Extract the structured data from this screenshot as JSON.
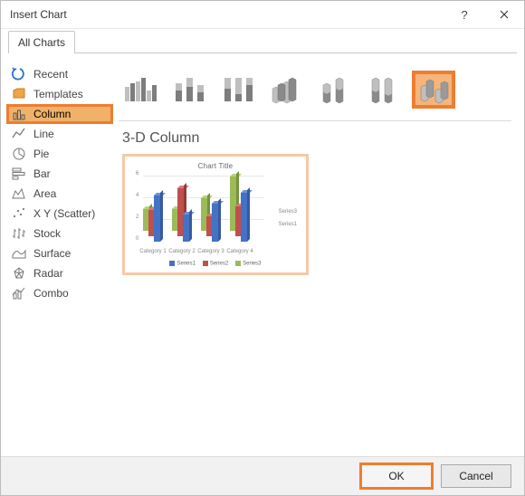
{
  "window": {
    "title": "Insert Chart"
  },
  "tabs": {
    "all": "All Charts"
  },
  "sidebar": {
    "items": [
      {
        "label": "Recent"
      },
      {
        "label": "Templates"
      },
      {
        "label": "Column"
      },
      {
        "label": "Line"
      },
      {
        "label": "Pie"
      },
      {
        "label": "Bar"
      },
      {
        "label": "Area"
      },
      {
        "label": "X Y (Scatter)"
      },
      {
        "label": "Stock"
      },
      {
        "label": "Surface"
      },
      {
        "label": "Radar"
      },
      {
        "label": "Combo"
      }
    ],
    "selected_index": 2
  },
  "main": {
    "subtype_names": [
      "clustered-column",
      "stacked-column",
      "100pct-stacked-column",
      "3d-clustered-column",
      "3d-stacked-column",
      "3d-100pct-stacked-column",
      "3d-column"
    ],
    "selected_subtype_index": 6,
    "subtype_title": "3-D Column"
  },
  "preview": {
    "title": "Chart Title",
    "categories": [
      "Category 1",
      "Category 2",
      "Category 3",
      "Category 4"
    ],
    "series_names": [
      "Series1",
      "Series2",
      "Series3"
    ],
    "legend_labels": [
      "Series1",
      "Series2",
      "Series3"
    ],
    "series_right_labels": [
      "Series1",
      "Series3"
    ],
    "y_ticks": [
      0,
      2,
      4,
      6
    ]
  },
  "chart_data": {
    "type": "bar",
    "title": "Chart Title",
    "categories": [
      "Category 1",
      "Category 2",
      "Category 3",
      "Category 4"
    ],
    "series": [
      {
        "name": "Series1",
        "values": [
          4.3,
          2.5,
          3.5,
          4.5
        ],
        "color": "#4472c4"
      },
      {
        "name": "Series2",
        "values": [
          2.4,
          4.4,
          1.8,
          2.8
        ],
        "color": "#c0504d"
      },
      {
        "name": "Series3",
        "values": [
          2.0,
          2.0,
          3.0,
          5.0
        ],
        "color": "#9bbb59"
      }
    ],
    "ylim": [
      0,
      6
    ],
    "xlabel": "",
    "ylabel": ""
  },
  "footer": {
    "ok": "OK",
    "cancel": "Cancel"
  }
}
